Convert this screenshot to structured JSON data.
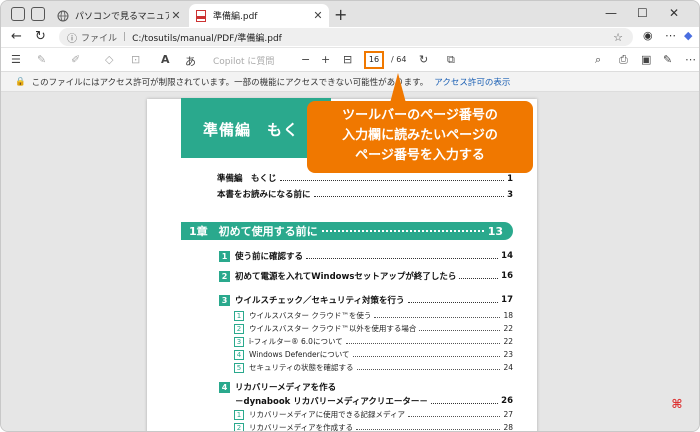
{
  "tabs": [
    {
      "title": "パソコンで見るマニュアル",
      "close": "✕"
    },
    {
      "title": "準備編.pdf",
      "close": "✕"
    }
  ],
  "new_tab": "+",
  "window": {
    "min": "—",
    "max": "☐",
    "close": "✕"
  },
  "address": {
    "label": "ファイル",
    "separator": "|",
    "url": "C:/tosutils/manual/PDF/準備編.pdf"
  },
  "toolbar": {
    "read_aloud": "A",
    "text_size": "あ",
    "copilot": "Copilot に質問",
    "zoom_out": "−",
    "zoom_in": "+",
    "page_number": "16",
    "page_total": "/ 64"
  },
  "infobar": {
    "message": "このファイルにはアクセス許可が制限されています。一部の機能にアクセスできない可能性があります。",
    "link": "アクセス許可の表示"
  },
  "document": {
    "header": "準備編　もく",
    "toc_top": [
      {
        "label": "準備編　もくじ",
        "page": "1"
      },
      {
        "label": "本書をお読みになる前に",
        "page": "3"
      }
    ],
    "chapter": {
      "label": "1章　初めて使用する前に",
      "page": "13"
    },
    "sections": [
      {
        "num": "1",
        "label": "使う前に確認する",
        "page": "14"
      },
      {
        "num": "2",
        "label": "初めて電源を入れてWindowsセットアップが終了したら",
        "page": "16"
      },
      {
        "num": "3",
        "label": "ウイルスチェック／セキュリティ対策を行う",
        "page": "17"
      }
    ],
    "subs3": [
      {
        "num": "1",
        "label": "ウイルスバスター クラウド™を使う",
        "page": "18"
      },
      {
        "num": "2",
        "label": "ウイルスバスター クラウド™以外を使用する場合",
        "page": "22"
      },
      {
        "num": "3",
        "label": "i-フィルター® 6.0について",
        "page": "22"
      },
      {
        "num": "4",
        "label": "Windows Defenderについて",
        "page": "23"
      },
      {
        "num": "5",
        "label": "セキュリティの状態を確認する",
        "page": "24"
      }
    ],
    "section4": {
      "num": "4",
      "line1": "リカバリーメディアを作る",
      "line2": "－dynabook リカバリーメディアクリエーター－",
      "page": "26"
    },
    "subs4": [
      {
        "num": "1",
        "label": "リカバリーメディアに使用できる記録メディア",
        "page": "27"
      },
      {
        "num": "2",
        "label": "リカバリーメディアを作成する",
        "page": "28"
      }
    ]
  },
  "callout": {
    "line1": "ツールバーのページ番号の",
    "line2": "入力欄に読みたいページの",
    "line3": "ページ番号を入力する"
  },
  "colors": {
    "accent": "#2aa98d",
    "callout": "#f07800"
  }
}
